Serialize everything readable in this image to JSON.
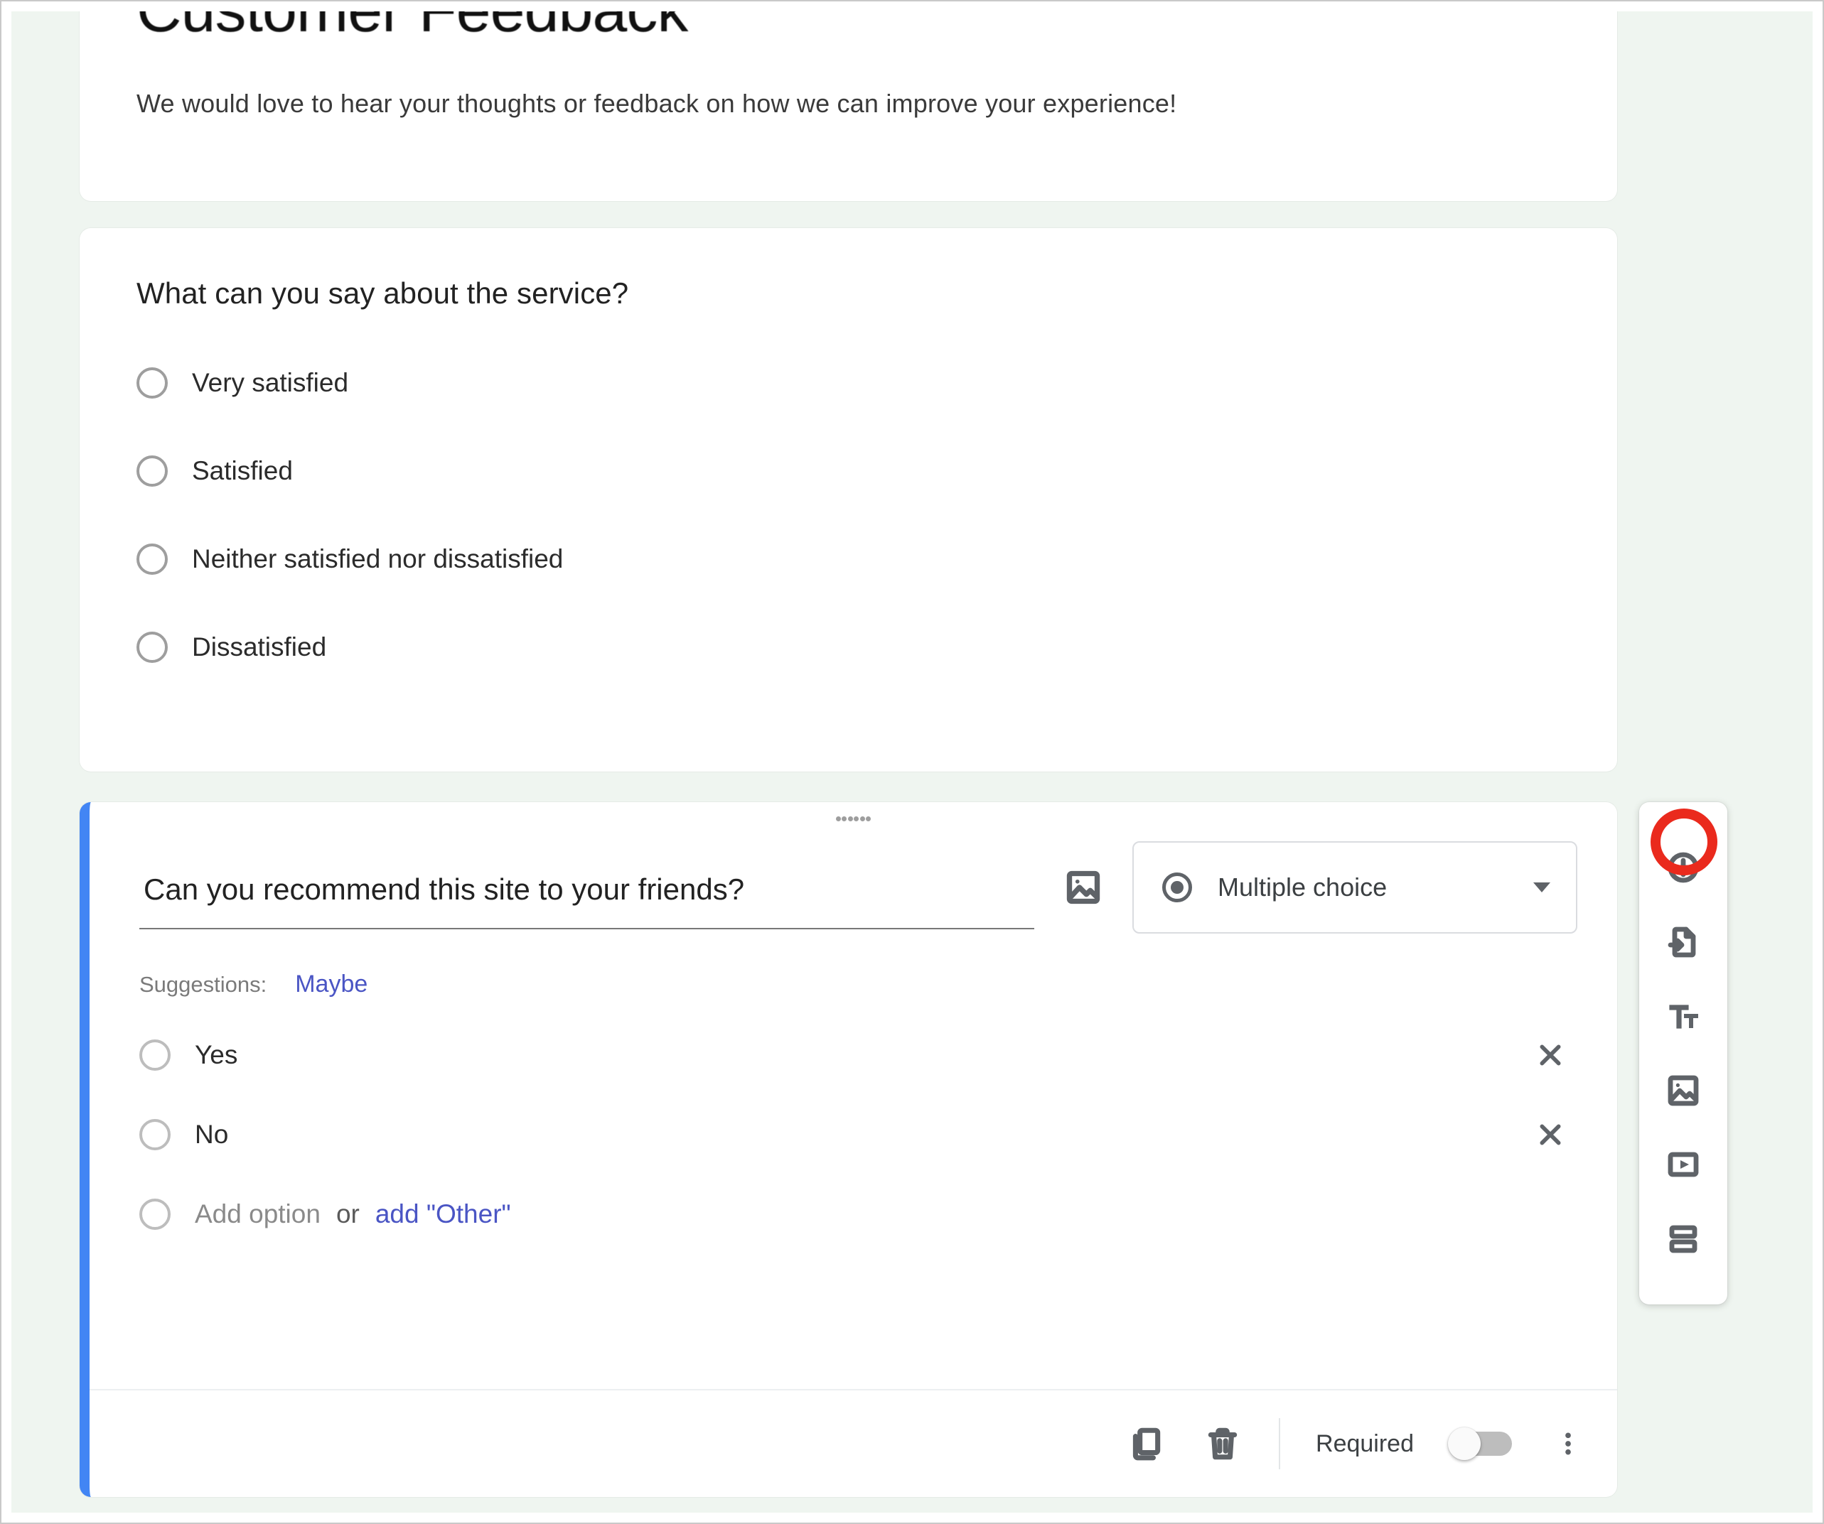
{
  "header": {
    "title_hidden": "Customer Feedback",
    "description": "We would love to hear your thoughts or feedback on how we can improve your experience!"
  },
  "question1": {
    "title": "What can you say about the service?",
    "options": [
      "Very satisfied",
      "Satisfied",
      "Neither satisfied nor dissatisfied",
      "Dissatisfied"
    ]
  },
  "question2": {
    "title": "Can you recommend this site to your friends?",
    "type_label": "Multiple choice",
    "suggestions_label": "Suggestions:",
    "suggestion_chip": "Maybe",
    "options": [
      "Yes",
      "No"
    ],
    "add_option_text": "Add option",
    "or_text": "or",
    "add_other_text": "add \"Other\"",
    "required_label": "Required",
    "required_on": false
  },
  "side_toolbar": {
    "items": [
      "add-question",
      "import-questions",
      "add-title-description",
      "add-image",
      "add-video",
      "add-section"
    ]
  }
}
